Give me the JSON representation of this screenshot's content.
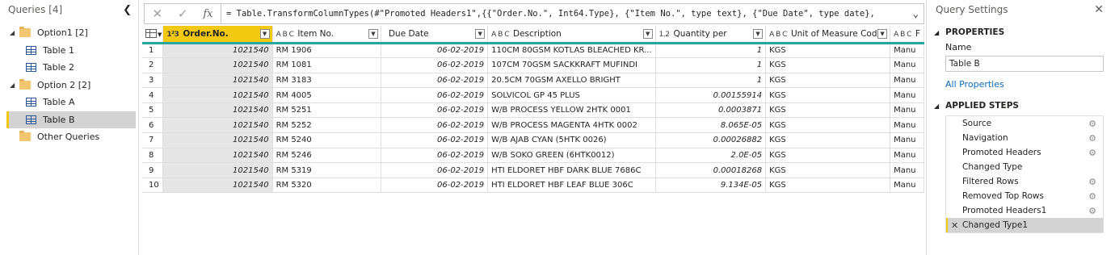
{
  "queries": {
    "title": "Queries [4]",
    "groups": [
      {
        "label": "Option1 [2]",
        "items": [
          "Table 1",
          "Table 2"
        ]
      },
      {
        "label": "Option 2 [2]",
        "items": [
          "Table A",
          "Table B"
        ]
      }
    ],
    "other": "Other Queries",
    "selected": "Table B"
  },
  "formula": {
    "text": "= Table.TransformColumnTypes(#\"Promoted Headers1\",{{\"Order.No.\", Int64.Type}, {\"Item No.\", type text}, {\"Due Date\", type date},",
    "fx": "fx"
  },
  "grid": {
    "columns": [
      {
        "type": "1²3",
        "label": "Order.No."
      },
      {
        "type": "A B C",
        "label": "Item No."
      },
      {
        "type": "",
        "label": "Due Date"
      },
      {
        "type": "A B C",
        "label": "Description"
      },
      {
        "type": "1.2",
        "label": "Quantity per"
      },
      {
        "type": "A B C",
        "label": "Unit of Measure Code"
      },
      {
        "type": "A B C",
        "label": "F"
      }
    ],
    "rows": [
      [
        "1",
        "1021540",
        "RM 1906",
        "06-02-2019",
        "110CM 80GSM KOTLAS BLEACHED KR...",
        "1",
        "KGS",
        "Manu"
      ],
      [
        "2",
        "1021540",
        "RM 1081",
        "06-02-2019",
        "107CM 70GSM SACKKRAFT MUFINDI",
        "1",
        "KGS",
        "Manu"
      ],
      [
        "3",
        "1021540",
        "RM 3183",
        "06-02-2019",
        "20.5CM 70GSM AXELLO BRIGHT",
        "1",
        "KGS",
        "Manu"
      ],
      [
        "4",
        "1021540",
        "RM 4005",
        "06-02-2019",
        "SOLVICOL GP 45 PLUS",
        "0.00155914",
        "KGS",
        "Manu"
      ],
      [
        "5",
        "1021540",
        "RM 5251",
        "06-02-2019",
        "W/B PROCESS YELLOW 2HTK 0001",
        "0.0003871",
        "KGS",
        "Manu"
      ],
      [
        "6",
        "1021540",
        "RM 5252",
        "06-02-2019",
        "W/B PROCESS MAGENTA 4HTK 0002",
        "8.065E-05",
        "KGS",
        "Manu"
      ],
      [
        "7",
        "1021540",
        "RM 5240",
        "06-02-2019",
        "W/B AJAB CYAN (5HTK 0026)",
        "0.00026882",
        "KGS",
        "Manu"
      ],
      [
        "8",
        "1021540",
        "RM 5246",
        "06-02-2019",
        "W/B SOKO GREEN (6HTK0012)",
        "2.0E-05",
        "KGS",
        "Manu"
      ],
      [
        "9",
        "1021540",
        "RM 5319",
        "06-02-2019",
        "HTI ELDORET HBF DARK BLUE 7686C",
        "0.00018268",
        "KGS",
        "Manu"
      ],
      [
        "10",
        "1021540",
        "RM 5320",
        "06-02-2019",
        "HTI ELDORET HBF LEAF BLUE 306C",
        "9.134E-05",
        "KGS",
        "Manu"
      ]
    ]
  },
  "settings": {
    "title": "Query Settings",
    "properties_title": "PROPERTIES",
    "name_label": "Name",
    "name_value": "Table B",
    "all_properties": "All Properties",
    "steps_title": "APPLIED STEPS",
    "steps": [
      {
        "label": "Source",
        "gear": true
      },
      {
        "label": "Navigation",
        "gear": true
      },
      {
        "label": "Promoted Headers",
        "gear": true
      },
      {
        "label": "Changed Type",
        "gear": false
      },
      {
        "label": "Filtered Rows",
        "gear": true
      },
      {
        "label": "Removed Top Rows",
        "gear": true
      },
      {
        "label": "Promoted Headers1",
        "gear": true
      },
      {
        "label": "Changed Type1",
        "gear": false,
        "active": true
      }
    ]
  }
}
